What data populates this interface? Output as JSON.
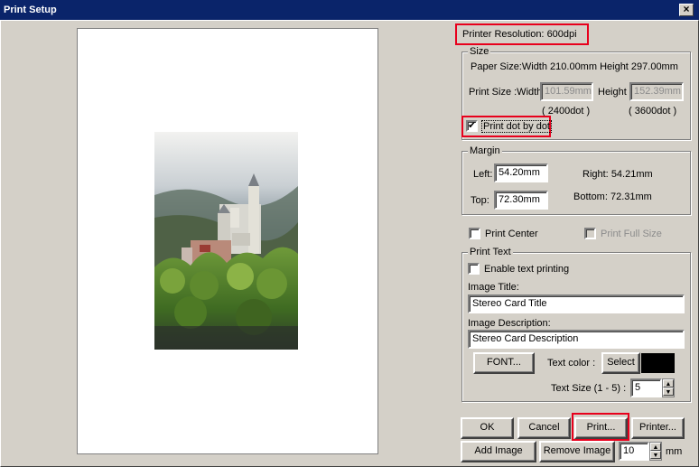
{
  "window": {
    "title": "Print Setup",
    "close_label": "×"
  },
  "printer_resolution": {
    "label": "Printer Resolution:",
    "value": "600dpi"
  },
  "size": {
    "legend": "Size",
    "paper_size": "Paper Size:Width 210.00mm Height 297.00mm",
    "print_size_label": "Print Size :Width",
    "width_value": "101.59mm",
    "height_label": "Height",
    "height_value": "152.39mm",
    "width_dots": "( 2400dot )",
    "height_dots": "( 3600dot )",
    "dot_by_dot_label": "Print dot by dot",
    "dot_by_dot_checked": true
  },
  "margin": {
    "legend": "Margin",
    "left_label": "Left:",
    "left_value": "54.20mm",
    "right_label": "Right:",
    "right_value": "54.21mm",
    "top_label": "Top:",
    "top_value": "72.30mm",
    "bottom_label": "Bottom:",
    "bottom_value": "72.31mm"
  },
  "options": {
    "print_center_label": "Print Center",
    "print_full_size_label": "Print Full Size"
  },
  "print_text": {
    "legend": "Print Text",
    "enable_label": "Enable text printing",
    "title_label": "Image Title:",
    "title_value": "Stereo Card Title",
    "description_label": "Image Description:",
    "description_value": "Stereo Card Description",
    "font_button": "FONT...",
    "text_color_label": "Text color :",
    "select_button": "Select",
    "text_color": "#000000",
    "text_size_label": "Text Size (1 - 5) :",
    "text_size_value": "5"
  },
  "buttons": {
    "ok": "OK",
    "cancel": "Cancel",
    "print": "Print...",
    "printer": "Printer...",
    "add_image": "Add Image",
    "remove_image": "Remove Image",
    "spacing_value": "10",
    "spacing_unit": "mm"
  },
  "colors": {
    "titlebar": "#0a246a",
    "highlight": "#e8001c",
    "face": "#d4d0c8"
  }
}
